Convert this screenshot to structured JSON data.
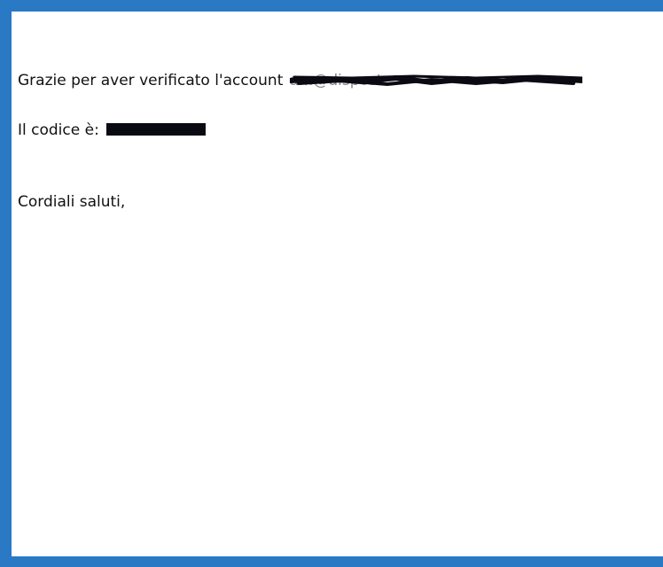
{
  "email": {
    "greeting_prefix": "Grazie per aver verificato l'account",
    "redacted_email": "a...@dispost...",
    "code_prefix": "Il codice è:",
    "closing": "Cordiali saluti,"
  },
  "colors": {
    "frame": "#2a79c4",
    "background": "#ffffff",
    "redaction": "#0a0a12"
  }
}
